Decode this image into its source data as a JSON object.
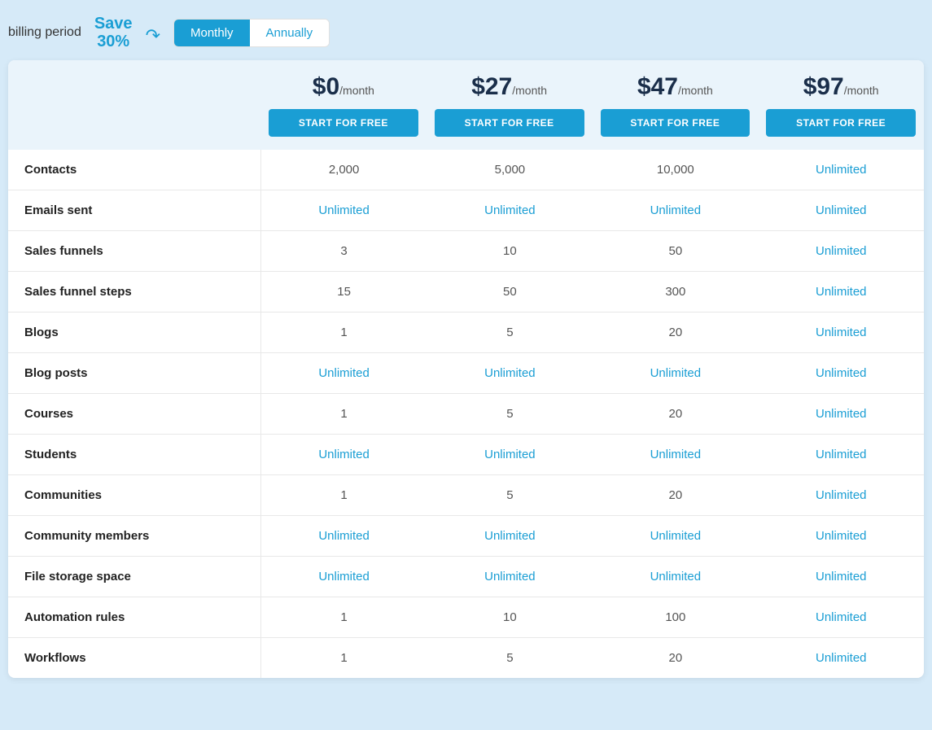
{
  "header": {
    "billing_period_label": "billing period",
    "save_badge": "Save\n30%",
    "toggle": {
      "monthly_label": "Monthly",
      "annually_label": "Annually",
      "active": "monthly"
    }
  },
  "plans": [
    {
      "price": "$0",
      "period": "/month",
      "cta": "START FOR FREE"
    },
    {
      "price": "$27",
      "period": "/month",
      "cta": "START FOR FREE"
    },
    {
      "price": "$47",
      "period": "/month",
      "cta": "START FOR FREE"
    },
    {
      "price": "$97",
      "period": "/month",
      "cta": "START FOR FREE"
    }
  ],
  "features": [
    {
      "name": "Contacts",
      "values": [
        "2,000",
        "5,000",
        "10,000",
        "Unlimited"
      ]
    },
    {
      "name": "Emails sent",
      "values": [
        "Unlimited",
        "Unlimited",
        "Unlimited",
        "Unlimited"
      ]
    },
    {
      "name": "Sales funnels",
      "values": [
        "3",
        "10",
        "50",
        "Unlimited"
      ]
    },
    {
      "name": "Sales funnel steps",
      "values": [
        "15",
        "50",
        "300",
        "Unlimited"
      ]
    },
    {
      "name": "Blogs",
      "values": [
        "1",
        "5",
        "20",
        "Unlimited"
      ]
    },
    {
      "name": "Blog posts",
      "values": [
        "Unlimited",
        "Unlimited",
        "Unlimited",
        "Unlimited"
      ]
    },
    {
      "name": "Courses",
      "values": [
        "1",
        "5",
        "20",
        "Unlimited"
      ]
    },
    {
      "name": "Students",
      "values": [
        "Unlimited",
        "Unlimited",
        "Unlimited",
        "Unlimited"
      ]
    },
    {
      "name": "Communities",
      "values": [
        "1",
        "5",
        "20",
        "Unlimited"
      ]
    },
    {
      "name": "Community members",
      "values": [
        "Unlimited",
        "Unlimited",
        "Unlimited",
        "Unlimited"
      ]
    },
    {
      "name": "File storage space",
      "values": [
        "Unlimited",
        "Unlimited",
        "Unlimited",
        "Unlimited"
      ]
    },
    {
      "name": "Automation rules",
      "values": [
        "1",
        "10",
        "100",
        "Unlimited"
      ]
    },
    {
      "name": "Workflows",
      "values": [
        "1",
        "5",
        "20",
        "Unlimited"
      ]
    }
  ]
}
